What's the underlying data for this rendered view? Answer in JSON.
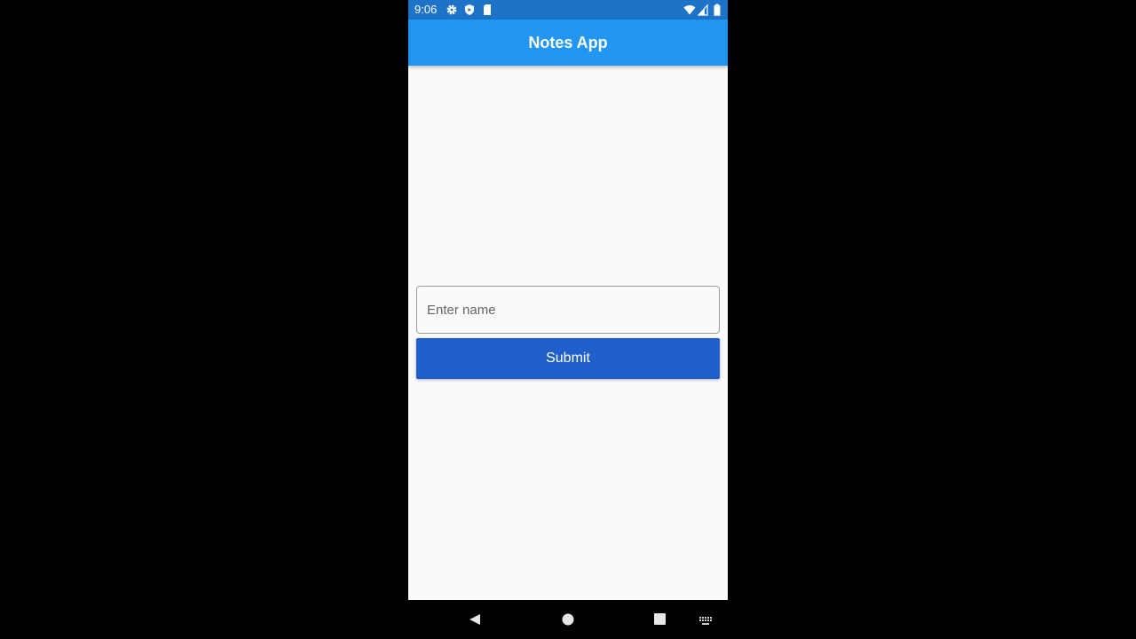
{
  "status_bar": {
    "time": "9:06",
    "left_icons": [
      "gear-icon",
      "shield-icon",
      "sd-card-icon"
    ],
    "right_icons": [
      "wifi-icon",
      "cell-signal-icon",
      "battery-icon"
    ],
    "background": "#1c73c7"
  },
  "app_bar": {
    "title": "Notes App",
    "background": "#2196f3"
  },
  "form": {
    "name_input": {
      "placeholder": "Enter name",
      "value": ""
    },
    "submit_label": "Submit",
    "submit_color": "#1e5fc9"
  },
  "nav_bar": {
    "buttons": [
      "back-icon",
      "home-icon",
      "recents-icon",
      "keyboard-icon"
    ]
  }
}
